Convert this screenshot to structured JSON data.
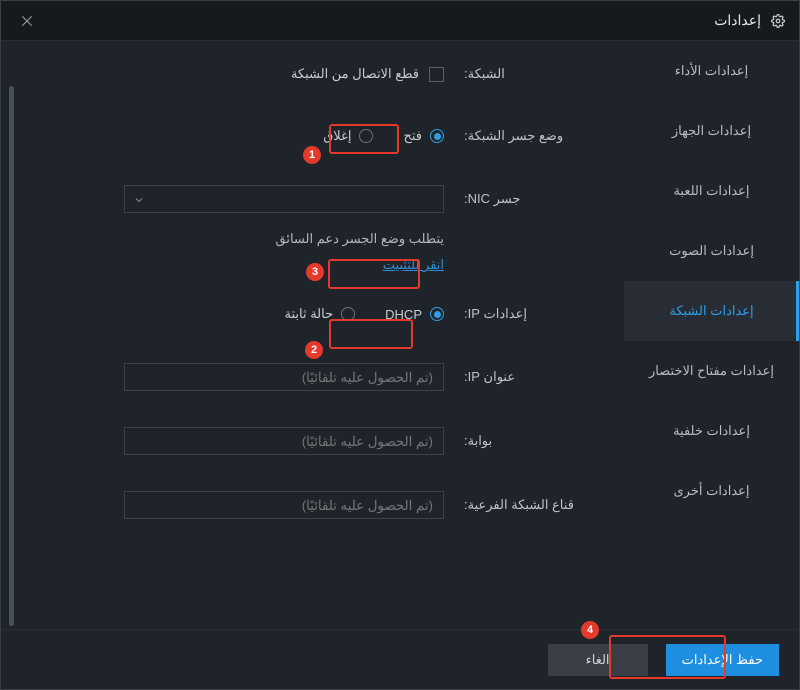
{
  "titlebar": {
    "title": "إعدادات"
  },
  "sidebar": {
    "items": [
      {
        "label": "إعدادات الأداء"
      },
      {
        "label": "إعدادات الجهاز"
      },
      {
        "label": "إعدادات اللعبة"
      },
      {
        "label": "إعدادات الصوت"
      },
      {
        "label": "إعدادات الشبكة"
      },
      {
        "label": "إعدادات مفتاح الاختصار"
      },
      {
        "label": "إعدادات خلفية"
      },
      {
        "label": "إعدادات أخرى"
      }
    ],
    "active_index": 4
  },
  "content": {
    "network_label": "الشبكة:",
    "disconnect_label": "قطع الاتصال من الشبكة",
    "bridge_mode_label": "وضع جسر الشبكة:",
    "bridge_open": "فتح",
    "bridge_close": "إغلاق",
    "nic_bridge_label": "جسر NIC:",
    "helper_text": "يتطلب وضع الجسر دعم السائق",
    "install_link": "انقر للتثبيت",
    "ip_settings_label": "إعدادات IP:",
    "dhcp": "DHCP",
    "static_ip": "حالة ثابتة",
    "ip_address_label": "عنوان IP:",
    "gateway_label": "بوابة:",
    "subnet_label": "قناع الشبكة الفرعية:",
    "auto_obtain_placeholder": "(تم الحصول عليه تلقائيًا)"
  },
  "footer": {
    "save": "حفظ الإعدادات",
    "cancel": "الغاء"
  },
  "annotations": {
    "b1": "1",
    "b2": "2",
    "b3": "3",
    "b4": "4"
  }
}
